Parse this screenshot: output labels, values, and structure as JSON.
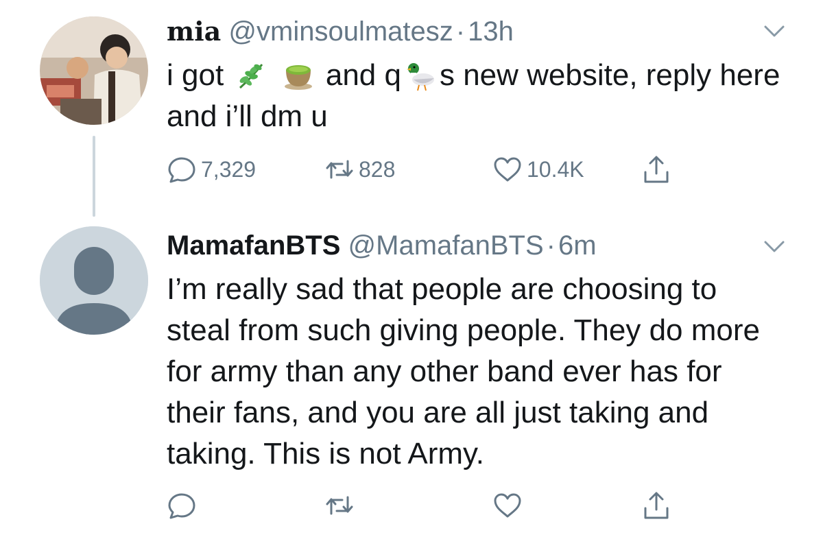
{
  "tweets": [
    {
      "display_name": "mia",
      "handle": "@vminsoulmatesz",
      "separator": "·",
      "time": "13h",
      "body": {
        "part1": "i got ",
        "part2": " and q",
        "part3": "s new website, reply here and i’ll dm u",
        "emojis": [
          "herb-emoji",
          "teacup-emoji",
          "duck-emoji"
        ]
      },
      "stats": {
        "replies": "7,329",
        "retweets": "828",
        "likes": "10.4K"
      }
    },
    {
      "display_name": "MamafanBTS",
      "handle": "@MamafanBTS",
      "separator": "·",
      "time": "6m",
      "body_text": "I’m really sad that people are choosing to steal from such giving people. They do more for army than any other band ever has for their fans, and you are all just taking and taking. This is not Army.",
      "stats": {
        "replies": "",
        "retweets": "",
        "likes": ""
      }
    }
  ],
  "colors": {
    "text": "#14171a",
    "secondary": "#657786",
    "thread_line": "#ccd6dd",
    "default_avatar_bg": "#ccd6dd",
    "default_avatar_fg": "#657786"
  },
  "icons": [
    "chevron-down-icon",
    "reply-icon",
    "retweet-icon",
    "like-icon",
    "share-icon"
  ]
}
